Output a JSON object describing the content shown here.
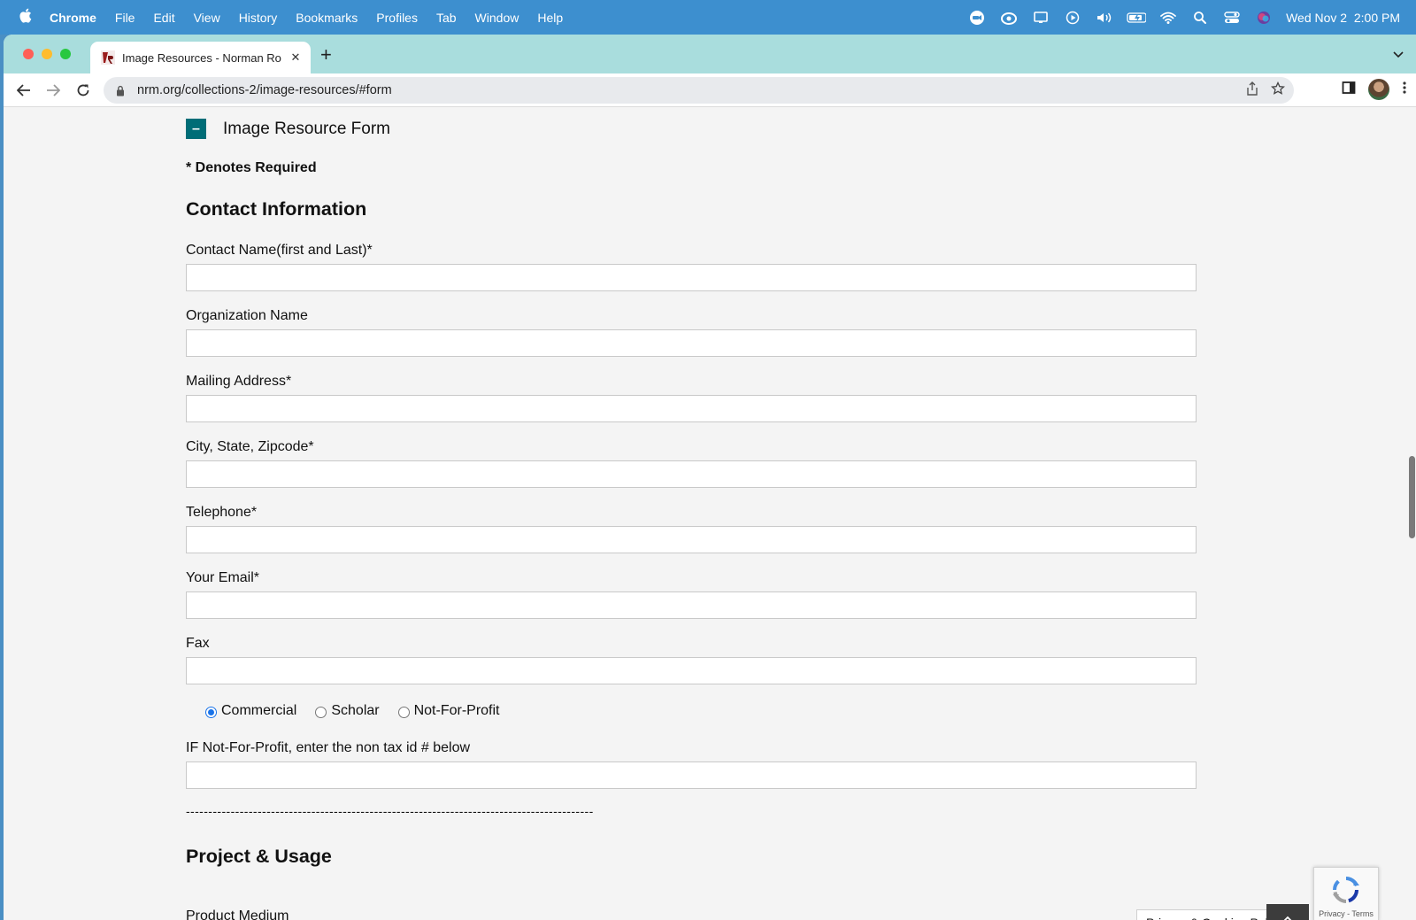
{
  "menubar": {
    "apple_icon": "apple-logo-icon",
    "items": [
      "Chrome",
      "File",
      "Edit",
      "View",
      "History",
      "Bookmarks",
      "Profiles",
      "Tab",
      "Window",
      "Help"
    ],
    "datetime": "Wed Nov 2  2:00 PM"
  },
  "browser": {
    "tab_title": "Image Resources - Norman Ro",
    "url": "nrm.org/collections-2/image-resources/#form"
  },
  "form": {
    "accordion_title": "Image Resource Form",
    "accordion_toggle": "–",
    "required_note": "* Denotes Required",
    "section_contact": "Contact Information",
    "fields": [
      {
        "label": "Contact Name(first and Last)*",
        "value": ""
      },
      {
        "label": "Organization Name",
        "value": ""
      },
      {
        "label": "Mailing Address*",
        "value": ""
      },
      {
        "label": "City, State, Zipcode*",
        "value": ""
      },
      {
        "label": "Telephone*",
        "value": ""
      },
      {
        "label": "Your Email*",
        "value": ""
      },
      {
        "label": "Fax",
        "value": ""
      }
    ],
    "radios": [
      {
        "label": "Commercial",
        "checked": true
      },
      {
        "label": "Scholar",
        "checked": false
      },
      {
        "label": "Not-For-Profit",
        "checked": false
      }
    ],
    "tax_id_label": "IF Not-For-Profit, enter the non tax id # below",
    "tax_id_value": "",
    "divider": "-------------------------------------------------------------------------------------------",
    "section_project": "Project & Usage",
    "product_medium_label": "Product Medium"
  },
  "overlays": {
    "recaptcha_text": "Privacy - Terms",
    "cookies_label": "Privacy & Cookies Policy"
  }
}
